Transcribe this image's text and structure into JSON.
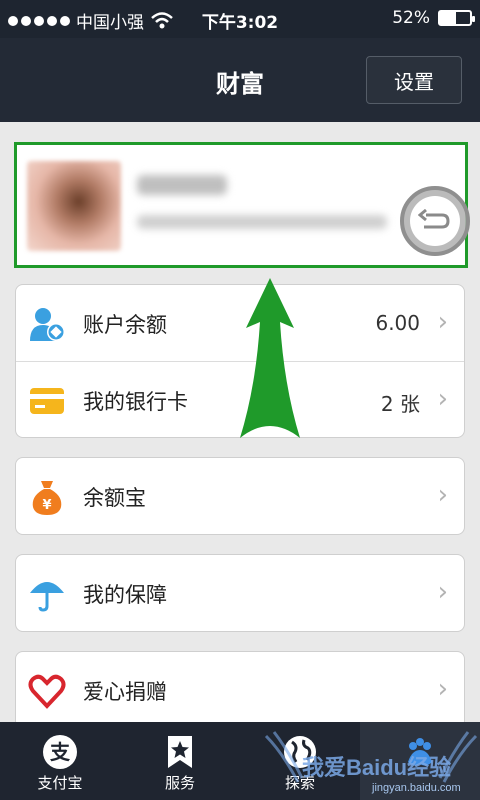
{
  "status_bar": {
    "carrier": "中国小强",
    "time": "下午3:02",
    "battery_percent": "52%",
    "battery_level": 0.52
  },
  "nav": {
    "title": "财富",
    "settings_label": "设置"
  },
  "profile": {
    "avatar_icon": "avatar-blurred",
    "chevron": "›"
  },
  "list": {
    "balance_label": "账户余额",
    "balance_value": "6.00",
    "bankcard_label": "我的银行卡",
    "bankcard_value": "2 张",
    "yuebao_label": "余额宝",
    "insurance_label": "我的保障",
    "charity_label": "爱心捐赠",
    "chevron": "›"
  },
  "tabbar": {
    "tabs": [
      {
        "label": "支付宝",
        "icon": "alipay-icon"
      },
      {
        "label": "服务",
        "icon": "star-bookmark-icon"
      },
      {
        "label": "探索",
        "icon": "globe-icon"
      },
      {
        "label": "",
        "icon": "wealth-icon"
      }
    ]
  },
  "watermark": {
    "text": "我爱Baidu经验",
    "sub": "jingyan.baidu.com"
  },
  "colors": {
    "highlight_green": "#1f9a2a",
    "navbar": "#232a36",
    "yuebao_orange": "#f07d1e",
    "balance_blue": "#3aa0e0",
    "card_yellow": "#f5b51c",
    "charity_red": "#d8262e"
  }
}
